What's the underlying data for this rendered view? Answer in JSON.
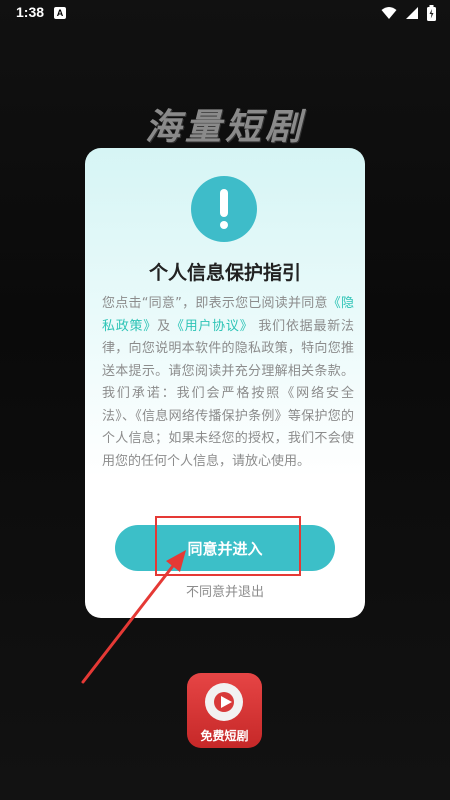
{
  "status_bar": {
    "time": "1:38",
    "notification_letter": "A"
  },
  "background": {
    "title": "海量短剧"
  },
  "dialog": {
    "title": "个人信息保护指引",
    "body_prefix": "您点击“同意”，即表示您已阅读并同意",
    "privacy_link": "《隐私政策》",
    "body_and": "及",
    "user_agreement_link": "《用户协议》",
    "body_rest": " 我们依据最新法律，向您说明本软件的隐私政策，特向您推送本提示。请您阅读并充分理解相关条款。我们承诺：我们会严格按照《网络安全法》、《信息网络传播保护条例》等保护您的个人信息；如果未经您的授权，我们不会使用您的任何个人信息，请放心使用。",
    "agree_label": "同意并进入",
    "disagree_label": "不同意并退出"
  },
  "app_logo": {
    "text": "免费短剧"
  },
  "colors": {
    "accent": "#3cbfc8",
    "link": "#2ec4b6",
    "annotation": "#e53935",
    "logo_red": "#d83a3a"
  },
  "icons": [
    "wifi-icon",
    "signal-icon",
    "battery-icon",
    "alert-icon",
    "play-icon"
  ]
}
